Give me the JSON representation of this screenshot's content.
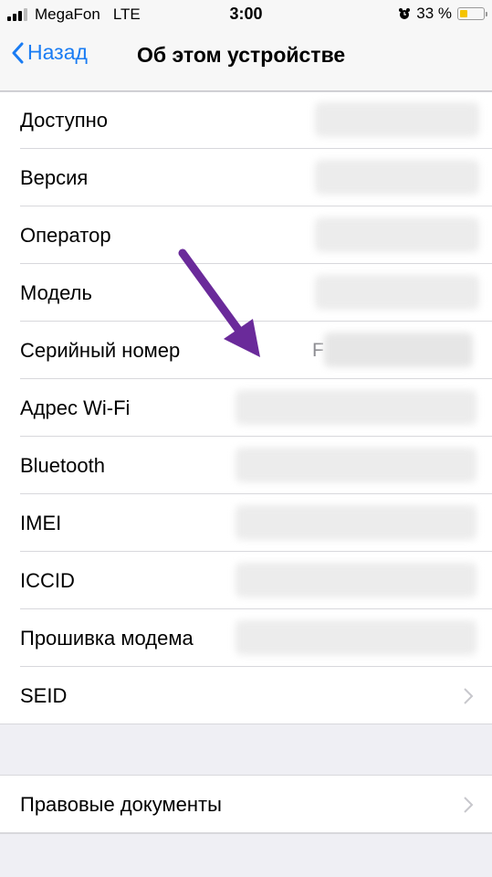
{
  "status_bar": {
    "carrier": "MegaFon",
    "network": "LTE",
    "time": "3:00",
    "battery_percent_label": "33 %",
    "battery_level": 0.33,
    "icons": [
      "signal-icon",
      "alarm-icon",
      "battery-icon"
    ]
  },
  "navbar": {
    "back_label": "Назад",
    "title": "Об этом устройстве"
  },
  "rows": [
    {
      "label": "Доступно",
      "value": "",
      "redacted": true
    },
    {
      "label": "Версия",
      "value": "",
      "redacted": true
    },
    {
      "label": "Оператор",
      "value": "",
      "redacted": true
    },
    {
      "label": "Модель",
      "value": "",
      "redacted": true
    },
    {
      "label": "Серийный номер",
      "value": "F",
      "redacted": true
    },
    {
      "label": "Адрес Wi-Fi",
      "value": "",
      "redacted": true
    },
    {
      "label": "Bluetooth",
      "value": "",
      "redacted": true
    },
    {
      "label": "IMEI",
      "value": "",
      "redacted": true
    },
    {
      "label": "ICCID",
      "value": "",
      "redacted": true
    },
    {
      "label": "Прошивка модема",
      "value": "",
      "redacted": true
    },
    {
      "label": "SEID",
      "value": "",
      "chevron": true
    }
  ],
  "legal": {
    "label": "Правовые документы",
    "chevron": true
  },
  "annotation": {
    "type": "arrow",
    "color": "#6a2a9a",
    "points_to": "Серийный номер"
  },
  "colors": {
    "accent": "#1a7cf3",
    "battery": "#f5c400",
    "background": "#efeff4"
  }
}
